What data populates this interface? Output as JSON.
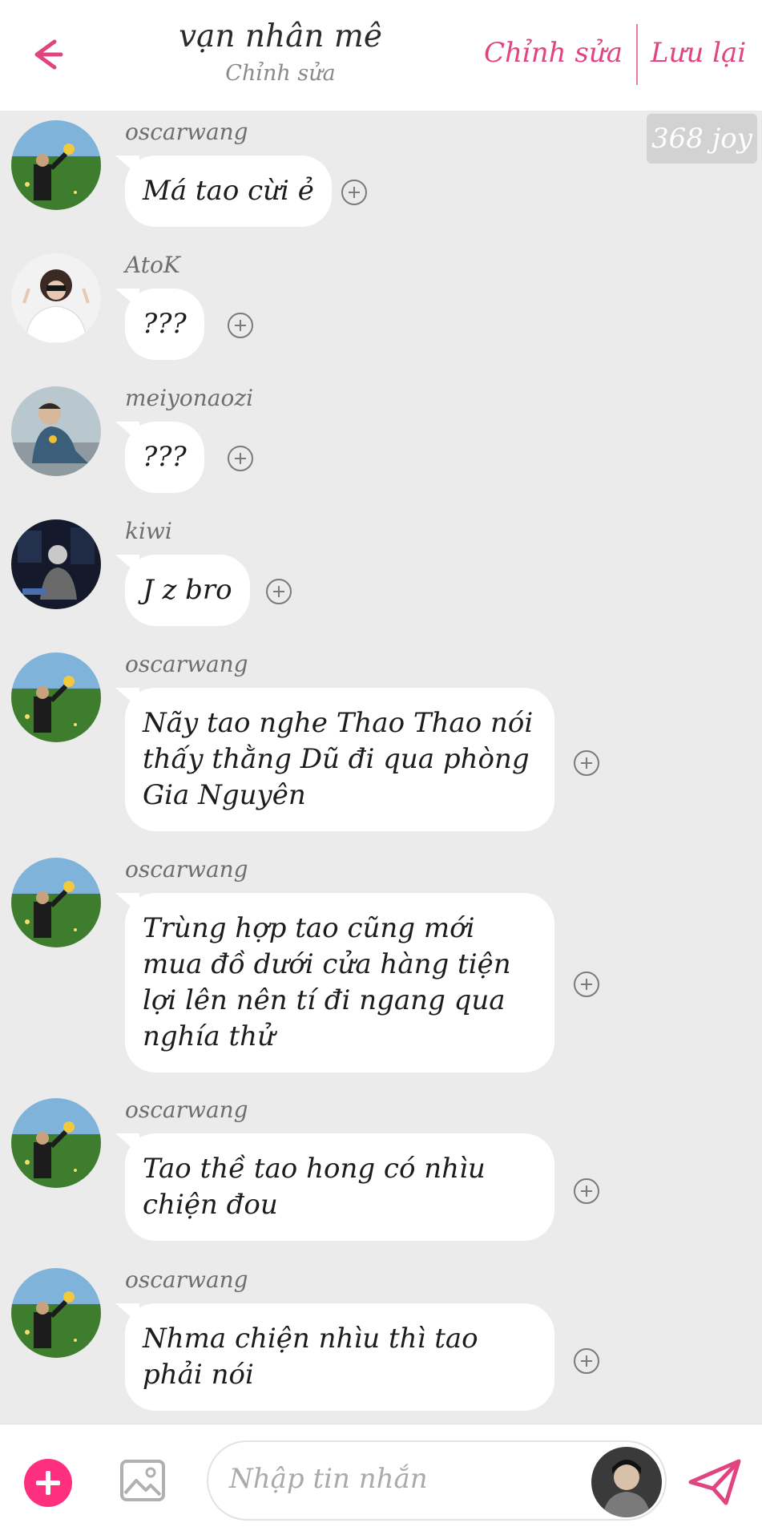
{
  "header": {
    "title": "vạn nhân mê",
    "subtitle": "Chỉnh sửa",
    "edit_label": "Chỉnh sửa",
    "save_label": "Lưu lại",
    "back_icon": "arrow-left-icon",
    "accent_color": "#e0457f"
  },
  "joy_badge": "368 joy",
  "messages": [
    {
      "user": "oscarwang",
      "text": "Má tao cừi ẻ",
      "avatar": "field-flowers"
    },
    {
      "user": "AtoK",
      "text": "???",
      "avatar": "white-hoodie"
    },
    {
      "user": "meiyonaozi",
      "text": "???",
      "avatar": "sitting-boy"
    },
    {
      "user": "kiwi",
      "text": "J z bro",
      "avatar": "dark-studio"
    },
    {
      "user": "oscarwang",
      "text": "Nãy tao nghe Thao Thao nói thấy thằng Dũ đi qua phòng Gia Nguyên",
      "avatar": "field-flowers"
    },
    {
      "user": "oscarwang",
      "text": "Trùng hợp tao cũng mới mua đồ dưới cửa hàng tiện lợi lên nên tí đi ngang qua nghía thử",
      "avatar": "field-flowers"
    },
    {
      "user": "oscarwang",
      "text": "Tao thề tao hong có nhìu chiện đou",
      "avatar": "field-flowers"
    },
    {
      "user": "oscarwang",
      "text": "Nhma chiện nhìu thì tao phải nói",
      "avatar": "field-flowers"
    }
  ],
  "composer": {
    "placeholder": "Nhập tin nhắn",
    "add_icon": "plus-circle-icon",
    "image_icon": "image-icon",
    "send_icon": "send-icon",
    "add_color": "#ff2f7f"
  }
}
